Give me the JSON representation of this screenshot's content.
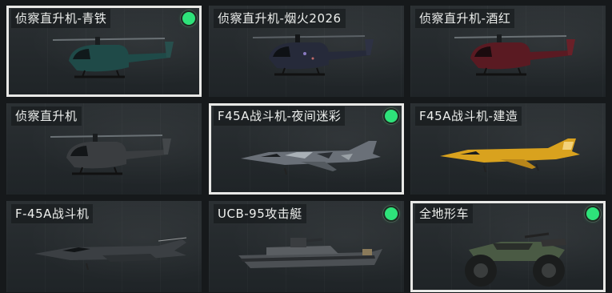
{
  "items": [
    {
      "name": "侦察直升机-青铁",
      "owned": true,
      "selected": true,
      "color": "#1f4a48"
    },
    {
      "name": "侦察直升机-烟火2026",
      "owned": false,
      "selected": false,
      "color": "#262a3a"
    },
    {
      "name": "侦察直升机-酒红",
      "owned": false,
      "selected": false,
      "color": "#5a1a22"
    },
    {
      "name": "侦察直升机",
      "owned": false,
      "selected": false,
      "color": "#3a3d40"
    },
    {
      "name": "F45A战斗机-夜间迷彩",
      "owned": true,
      "selected": true,
      "color": "#6a7078"
    },
    {
      "name": "F45A战斗机-建造",
      "owned": false,
      "selected": false,
      "color": "#d9a21e"
    },
    {
      "name": "F-45A战斗机",
      "owned": false,
      "selected": false,
      "color": "#3b3f43"
    },
    {
      "name": "UCB-95攻击艇",
      "owned": true,
      "selected": false,
      "color": "#4c5054"
    },
    {
      "name": "全地形车",
      "owned": true,
      "selected": true,
      "color": "#4a5a44"
    }
  ],
  "icons": {
    "owned": "owned-indicator-icon"
  }
}
